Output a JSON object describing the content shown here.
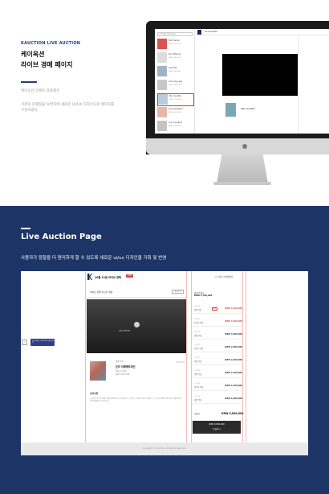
{
  "top": {
    "eyebrow": "KAUCTION LIVE AUCTION",
    "title_line1": "케이옥션",
    "title_line2": "라이브 경매 페이지",
    "desc1": "케이옥션 리액트 프로젝트",
    "desc2": "기존의 문제점을 보완하여 새로운 UI/UX 디자인으로 페이지를 구성하였다."
  },
  "imac": {
    "search_placeholder": "검색어를 입력하세요",
    "header_title": "Live Auction",
    "lots": [
      {
        "title": "Park Seobo",
        "sub": "KRW 1,200,000"
      },
      {
        "title": "Kim Whanki",
        "sub": "KRW 2,400,000"
      },
      {
        "title": "Lee Ufan",
        "sub": "KRW 3,000,000"
      },
      {
        "title": "Chun Kyungja",
        "sub": "KRW 1,800,000"
      },
      {
        "title": "Mac Anetha",
        "sub": "KRW 1,700,000"
      },
      {
        "title": "Jung Sanghwa",
        "sub": "KRW 2,100,000"
      },
      {
        "title": "Yoo Youngkuk",
        "sub": "KRW 2,600,000"
      }
    ],
    "lot_title": "Mac Anetha"
  },
  "bottom": {
    "title": "Live Auction Page",
    "desc": "사용자가 응찰을 더 편리하게 할 수 있도록 새로운 ui/ux 디자인을 기획 및 반영"
  },
  "panel": {
    "header_title": "10월 11일 라이브 경매",
    "live_badge": "LIVE",
    "user_label": "로그아웃  마이페이지",
    "bar2_text": "라이브 경매 실시간 영상",
    "bar2_button": "영상 보기",
    "video_caption": "라이브 경매 영상",
    "lot_no": "LOT 14",
    "artist": "온리 아메헤트라인",
    "detail1": "캔버스에 유채",
    "detail2": "KRW 2,000,000",
    "side_link": "작품 상세보기",
    "notice_title": "공지사항",
    "notice_text": "• 응찰 전 반드시 경매 약관을 확인해 주시기 바랍니다.  • 낙찰 시 구매수수료가 부과됩니다.  • 실시간 경매 중 네트워크 상황에 따라 지연이 발생할 수 있습니다.",
    "bid_header1": "현재 응찰가",
    "bid_header2": "KRW 1,700,000",
    "bid_rows": [
      {
        "l1": "현재 호가",
        "l2": "현장 응찰",
        "amt": "KRW 3,400,000",
        "tag": "LIVE",
        "hl": true
      },
      {
        "l1": "응찰 내역",
        "l2": "온라인 응찰",
        "amt": "KRW 3,200,000",
        "tag": "",
        "hl": true
      },
      {
        "l1": "응찰 내역",
        "l2": "현장 응찰",
        "amt": "KRW 3,000,000",
        "tag": "",
        "hl": false
      },
      {
        "l1": "응찰 내역",
        "l2": "온라인 응찰",
        "amt": "KRW 2,800,000",
        "tag": "",
        "hl": false
      },
      {
        "l1": "응찰 내역",
        "l2": "현장 응찰",
        "amt": "KRW 2,600,000",
        "tag": "",
        "hl": false
      },
      {
        "l1": "응찰 내역",
        "l2": "서면 응찰",
        "amt": "KRW 2,400,000",
        "tag": "",
        "hl": false
      },
      {
        "l1": "응찰 내역",
        "l2": "온라인 응찰",
        "amt": "KRW 2,200,000",
        "tag": "",
        "hl": false
      },
      {
        "l1": "응찰 내역",
        "l2": "현장 응찰",
        "amt": "KRW 2,000,000",
        "tag": "",
        "hl": false
      }
    ],
    "bid_sum_label": "응찰가",
    "bid_sum_value": "KRW 3,600,000",
    "bid_button_line1": "KRW 3,600,000",
    "bid_button_line2": "응찰하기",
    "tooltip_icon": "i",
    "tooltip_text": "응찰 버튼을 누르면 바로 응찰이 됩니다",
    "footer_text": "Copyright © K Auction. All Rights Reserved."
  },
  "colors": {
    "navy": "#1d3566",
    "accent": "#1f3f7a",
    "live_red": "#e0403b"
  }
}
